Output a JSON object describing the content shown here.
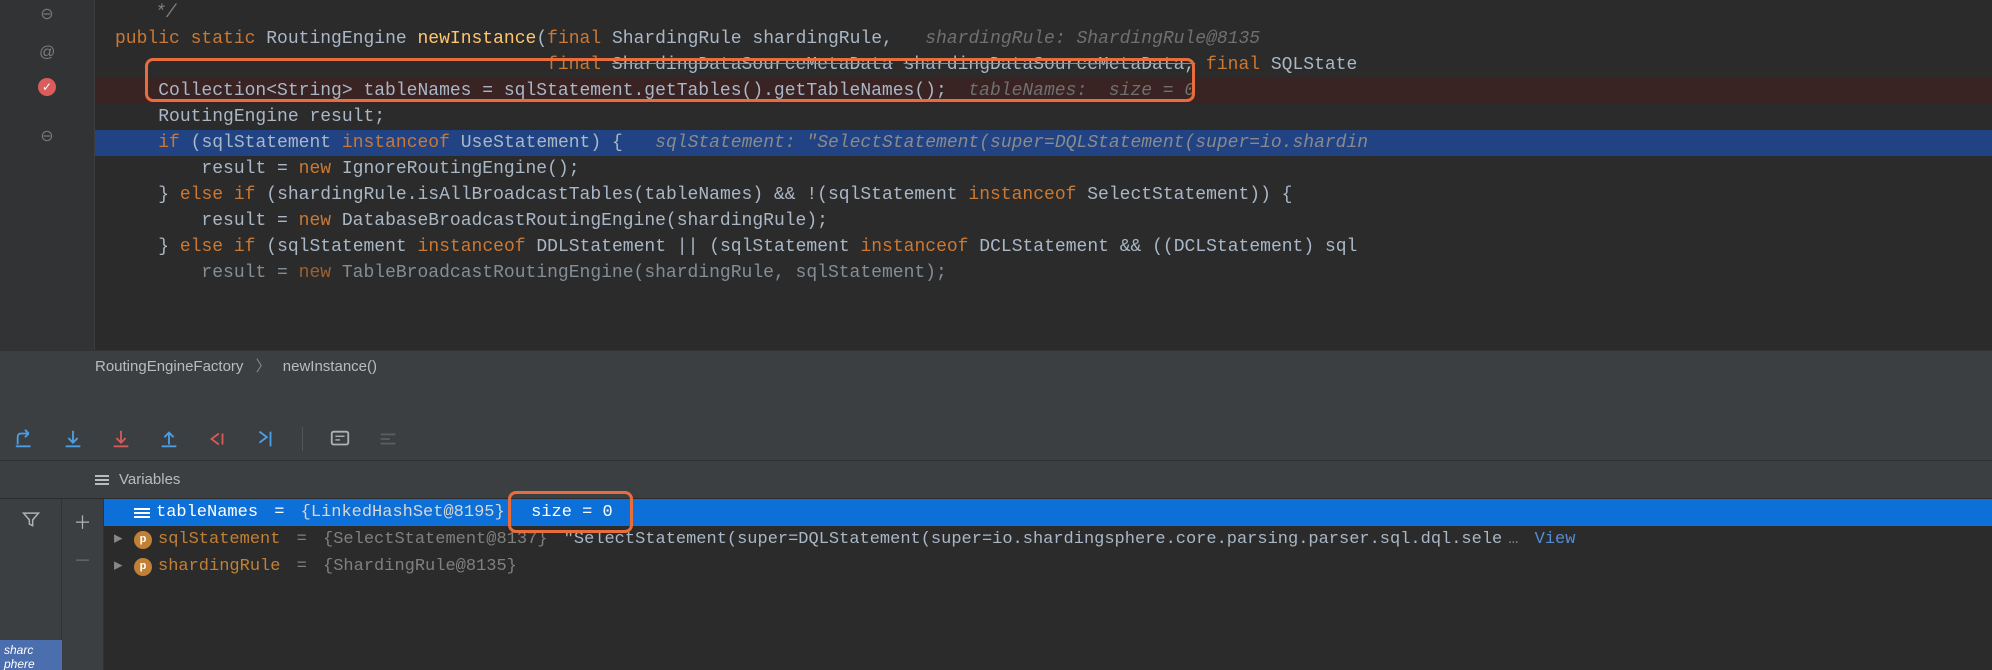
{
  "code": {
    "l0": "*/",
    "l1a": "public",
    "l1b": "static",
    "l1c": "RoutingEngine",
    "l1d": "newInstance",
    "l1e": "final",
    "l1f": "ShardingRule shardingRule,",
    "l1hint": "shardingRule: ShardingRule@8135",
    "l2a": "final",
    "l2b": "ShardingDataSourceMetaData",
    "l2c": "shardingDataSourceMetaData,",
    "l2d": "final",
    "l2e": "SQLState",
    "l3": "Collection<String> tableNames = sqlStatement.getTables().getTableNames();",
    "l3hint": "tableNames:  size = 0",
    "l4": "RoutingEngine result;",
    "l5a": "if",
    "l5b": "(sqlStatement",
    "l5c": "instanceof",
    "l5d": "UseStatement) {",
    "l5hint": "sqlStatement: \"SelectStatement(super=DQLStatement(super=io.shardin",
    "l6a": "result =",
    "l6b": "new",
    "l6c": "IgnoreRoutingEngine();",
    "l7a": "}",
    "l7b": "else if",
    "l7c": "(shardingRule.isAllBroadcastTables(tableNames) && !(sqlStatement",
    "l7d": "instanceof",
    "l7e": "SelectStatement)) {",
    "l8a": "result =",
    "l8b": "new",
    "l8c": "DatabaseBroadcastRoutingEngine(shardingRule);",
    "l9a": "}",
    "l9b": "else if",
    "l9c": "(sqlStatement",
    "l9d": "instanceof",
    "l9e": "DDLStatement || (sqlStatement",
    "l9f": "instanceof",
    "l9g": "DCLStatement && ((DCLStatement) sql",
    "l10a": "result =",
    "l10b": "new",
    "l10c": "TableBroadcastRoutingEngine(shardingRule, sqlStatement);"
  },
  "breadcrumb": {
    "a": "RoutingEngineFactory",
    "b": "newInstance()"
  },
  "vars_header": "Variables",
  "frames_label": "sharc\nphere",
  "variables": {
    "v1name": "tableNames",
    "v1eq": " = ",
    "v1cls": "{LinkedHashSet@8195}",
    "v1size": "  size = 0",
    "v2name": "sqlStatement",
    "v2eq": " = ",
    "v2cls": "{SelectStatement@8137} ",
    "v2str": "\"SelectStatement(super=DQLStatement(super=io.shardingsphere.core.parsing.parser.sql.dql.sele",
    "v2dots": "…",
    "v2view": " View",
    "v3name": "shardingRule",
    "v3eq": " = ",
    "v3cls": "{ShardingRule@8135}"
  },
  "gutter_at": "@"
}
